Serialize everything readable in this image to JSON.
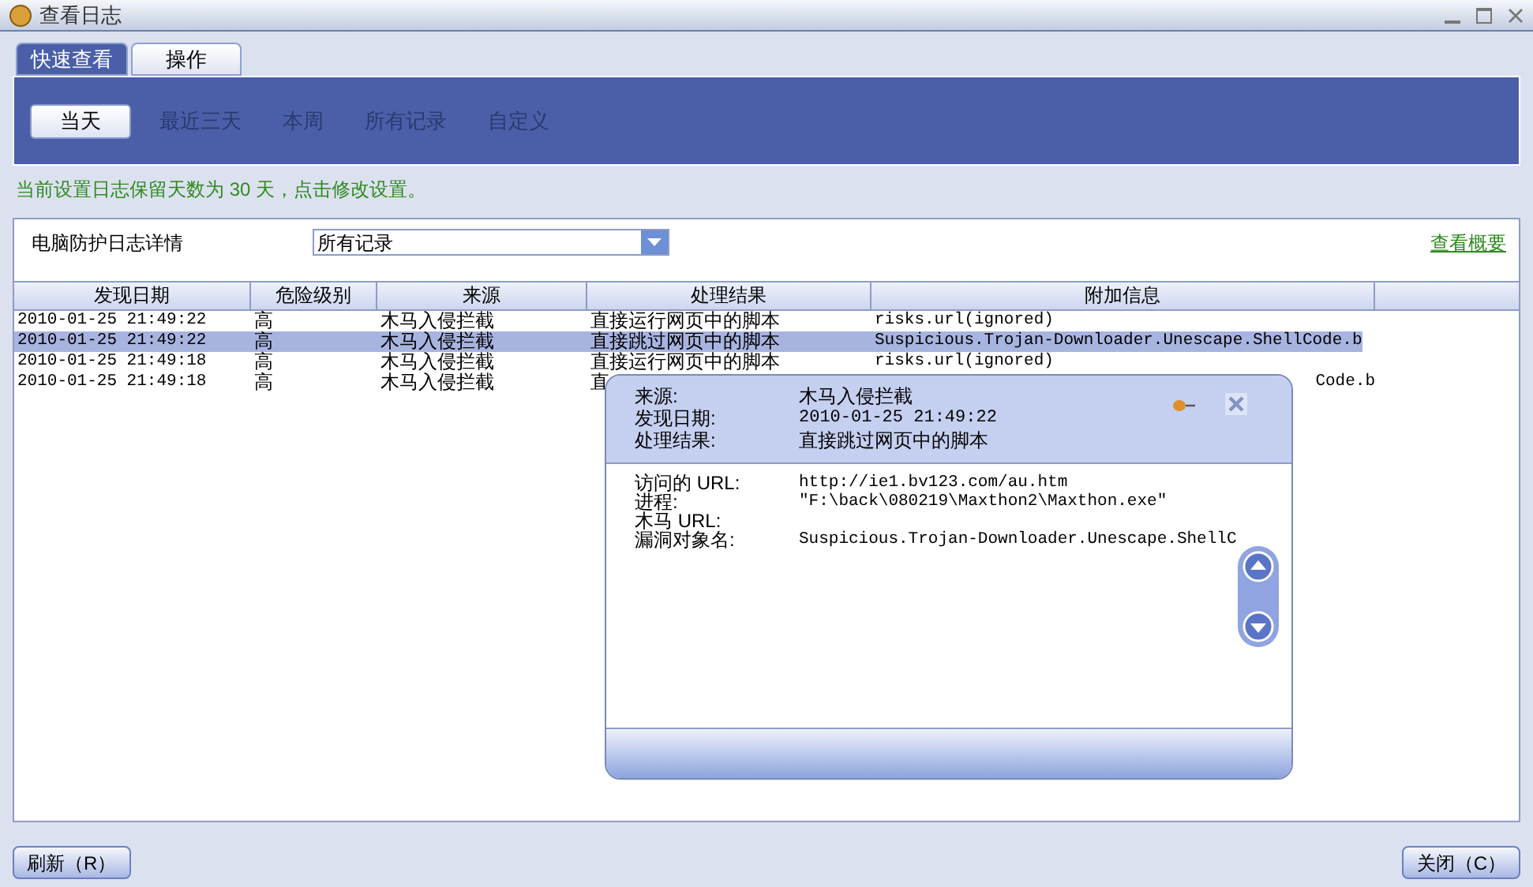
{
  "window": {
    "title": "查看日志"
  },
  "tabs": [
    {
      "label": "快速查看",
      "selected": true
    },
    {
      "label": "操作",
      "selected": false
    }
  ],
  "filters": [
    {
      "label": "当天",
      "selected": true
    },
    {
      "label": "最近三天",
      "selected": false
    },
    {
      "label": "本周",
      "selected": false
    },
    {
      "label": "所有记录",
      "selected": false
    },
    {
      "label": "自定义",
      "selected": false
    }
  ],
  "notice": "当前设置日志保留天数为 30 天，点击修改设置。",
  "panel": {
    "title": "电脑防护日志详情",
    "dropdown_value": "所有记录",
    "link": "查看概要"
  },
  "table": {
    "columns": [
      "发现日期",
      "危险级别",
      "来源",
      "处理结果",
      "附加信息"
    ],
    "rows": [
      {
        "cells": [
          "2010-01-25 21:49:22",
          "高",
          "木马入侵拦截",
          "直接运行网页中的脚本",
          "risks.url(ignored)"
        ],
        "selected": false
      },
      {
        "cells": [
          "2010-01-25 21:49:22",
          "高",
          "木马入侵拦截",
          "直接跳过网页中的脚本",
          "Suspicious.Trojan-Downloader.Unescape.ShellCode.b"
        ],
        "selected": true
      },
      {
        "cells": [
          "2010-01-25 21:49:18",
          "高",
          "木马入侵拦截",
          "直接运行网页中的脚本",
          "risks.url(ignored)"
        ],
        "selected": false
      },
      {
        "cells": [
          "2010-01-25 21:49:18",
          "高",
          "木马入侵拦截",
          "直",
          "Code.b"
        ],
        "selected": false
      }
    ]
  },
  "popup": {
    "header": [
      {
        "label": "来源:",
        "value": "木马入侵拦截"
      },
      {
        "label": "发现日期:",
        "value": "2010-01-25 21:49:22"
      },
      {
        "label": "处理结果:",
        "value": "直接跳过网页中的脚本"
      }
    ],
    "details": [
      {
        "label": "访问的 URL:",
        "value": "http://ie1.bv123.com/au.htm"
      },
      {
        "label": "进程:",
        "value": "\"F:\\back\\080219\\Maxthon2\\Maxthon.exe\""
      },
      {
        "label": "木马 URL:"
      },
      {
        "label": "漏洞对象名:",
        "value": "Suspicious.Trojan-Downloader.Unescape.ShellC"
      }
    ]
  },
  "buttons": [
    {
      "label": "刷新（R）"
    },
    {
      "label": "关闭（C）"
    }
  ]
}
